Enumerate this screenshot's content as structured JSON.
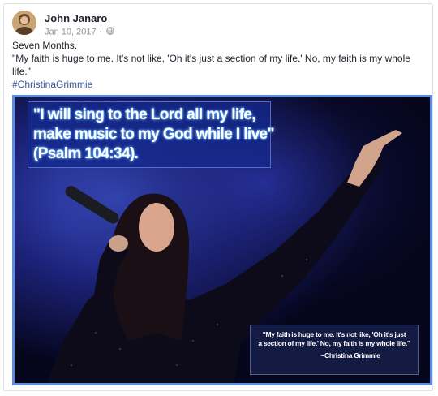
{
  "post": {
    "author": "John Janaro",
    "date": "Jan 10, 2017",
    "separator": "·",
    "privacy_icon": "globe-icon",
    "text": {
      "line1": "Seven Months.",
      "line2": "\"My faith is huge to me. It's not like, 'Oh it's just a section of my life.' No, my faith is my whole life.\"",
      "hashtag": "#ChristinaGrimmie"
    }
  },
  "image": {
    "verse": {
      "line1": "\"I will sing to the Lord all my life,",
      "line2": "make music to my God while I live\"",
      "line3": "(Psalm 104:34)."
    },
    "quote": {
      "line1": "\"My faith is huge to me. It's not like, 'Oh it's just",
      "line2": "a section of my life.' No, my faith is my whole life.\"",
      "attribution": "~Christina Grimmie"
    }
  },
  "colors": {
    "hashtag": "#365899",
    "photo_border": "#5b8ce8",
    "meta": "#90949c"
  }
}
